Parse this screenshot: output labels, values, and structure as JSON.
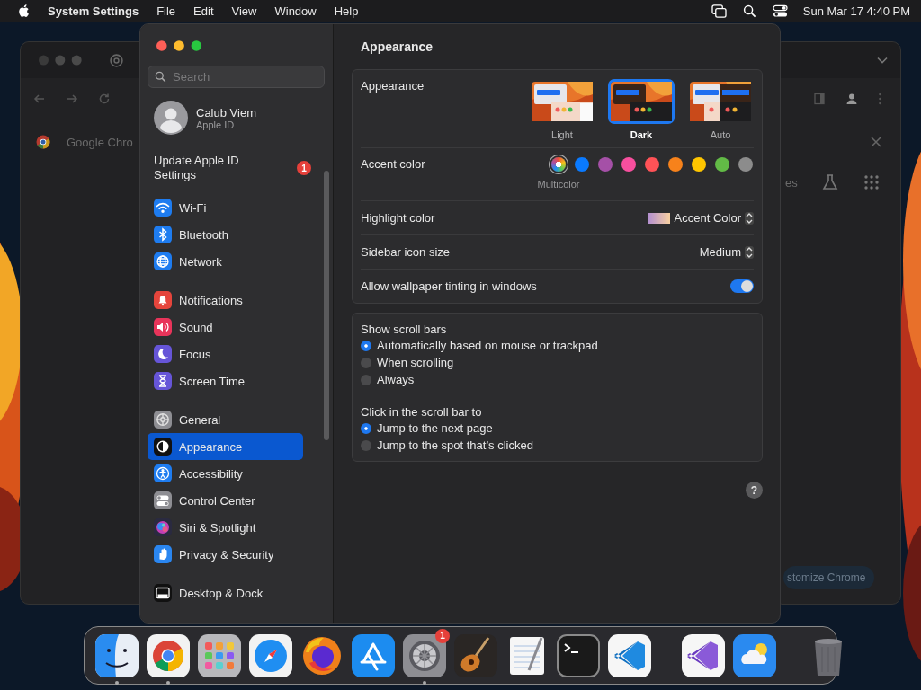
{
  "menu_bar": {
    "app_name": "System Settings",
    "menus": [
      "File",
      "Edit",
      "View",
      "Window",
      "Help"
    ],
    "clock": "Sun Mar 17  4:40 PM"
  },
  "background_windows": {
    "left_text": "Google Chro",
    "right_partial_text": "es",
    "right_button": "stomize Chrome"
  },
  "settings": {
    "title": "Appearance",
    "search": {
      "placeholder": "Search"
    },
    "account": {
      "name": "Calub Viem",
      "subtitle": "Apple ID"
    },
    "update": {
      "label": "Update Apple ID Settings",
      "badge": "1"
    },
    "sidebar": {
      "groups": [
        {
          "items": [
            {
              "label": "Wi-Fi",
              "kind": "wifi",
              "color": "#1e7cf0",
              "selected": false
            },
            {
              "label": "Bluetooth",
              "kind": "bluetooth",
              "color": "#1e7cf0",
              "selected": false
            },
            {
              "label": "Network",
              "kind": "globe",
              "color": "#1e7cf0",
              "selected": false
            }
          ]
        },
        {
          "items": [
            {
              "label": "Notifications",
              "kind": "bell",
              "color": "#e5453c",
              "selected": false
            },
            {
              "label": "Sound",
              "kind": "speaker",
              "color": "#e8345a",
              "selected": false
            },
            {
              "label": "Focus",
              "kind": "moon",
              "color": "#6655d8",
              "selected": false
            },
            {
              "label": "Screen Time",
              "kind": "hourglass",
              "color": "#6655d8",
              "selected": false
            }
          ]
        },
        {
          "items": [
            {
              "label": "General",
              "kind": "gear",
              "color": "#8e8e93",
              "selected": false
            },
            {
              "label": "Appearance",
              "kind": "contrast",
              "color": "#111111",
              "selected": true
            },
            {
              "label": "Accessibility",
              "kind": "accessibility",
              "color": "#1e7cf0",
              "selected": false
            },
            {
              "label": "Control Center",
              "kind": "toggles",
              "color": "#8e8e93",
              "selected": false
            },
            {
              "label": "Siri & Spotlight",
              "kind": "siri",
              "color": "#2a2a40",
              "selected": false
            },
            {
              "label": "Privacy & Security",
              "kind": "hand",
              "color": "#2a86f0",
              "selected": false
            }
          ]
        },
        {
          "items": [
            {
              "label": "Desktop & Dock",
              "kind": "dock",
              "color": "#111111",
              "selected": false
            }
          ]
        }
      ]
    },
    "appearance": {
      "label": "Appearance",
      "options": [
        {
          "label": "Light",
          "kind": "light",
          "selected": false
        },
        {
          "label": "Dark",
          "kind": "dark",
          "selected": true
        },
        {
          "label": "Auto",
          "kind": "auto",
          "selected": false
        }
      ]
    },
    "accent": {
      "label": "Accent color",
      "swatches": [
        {
          "kind": "multicolor",
          "label": "Multicolor",
          "selected": true
        },
        {
          "kind": "solid",
          "color": "#0a7aff",
          "selected": false
        },
        {
          "kind": "solid",
          "color": "#a550a7",
          "selected": false
        },
        {
          "kind": "solid",
          "color": "#f74f9e",
          "selected": false
        },
        {
          "kind": "solid",
          "color": "#ff5257",
          "selected": false
        },
        {
          "kind": "solid",
          "color": "#f7821b",
          "selected": false
        },
        {
          "kind": "solid",
          "color": "#ffc600",
          "selected": false
        },
        {
          "kind": "solid",
          "color": "#62ba46",
          "selected": false
        },
        {
          "kind": "solid",
          "color": "#8c8c8c",
          "selected": false
        }
      ]
    },
    "highlight": {
      "label": "Highlight color",
      "value": "Accent Color"
    },
    "icon_size": {
      "label": "Sidebar icon size",
      "value": "Medium"
    },
    "tinting": {
      "label": "Allow wallpaper tinting in windows",
      "on": true
    },
    "scroll_bars": {
      "title": "Show scroll bars",
      "options": [
        {
          "label": "Automatically based on mouse or trackpad",
          "selected": true
        },
        {
          "label": "When scrolling",
          "selected": false
        },
        {
          "label": "Always",
          "selected": false
        }
      ]
    },
    "click_scroll": {
      "title": "Click in the scroll bar to",
      "options": [
        {
          "label": "Jump to the next page",
          "selected": true
        },
        {
          "label": "Jump to the spot that’s clicked",
          "selected": false
        }
      ]
    },
    "help": "?"
  },
  "dock": {
    "groups": [
      {
        "items": [
          {
            "kind": "finder",
            "running": true
          },
          {
            "kind": "chrome",
            "running": true
          },
          {
            "kind": "launchpad",
            "running": false
          },
          {
            "kind": "safari",
            "running": false
          },
          {
            "kind": "firefox",
            "running": false
          },
          {
            "kind": "appstore",
            "running": false
          },
          {
            "kind": "settings",
            "running": true,
            "badge": "1"
          },
          {
            "kind": "guitar",
            "running": false
          },
          {
            "kind": "textedit",
            "running": false
          },
          {
            "kind": "terminal",
            "running": false
          },
          {
            "kind": "vscode",
            "running": false
          }
        ]
      },
      {
        "items": [
          {
            "kind": "visualstudio",
            "running": false
          },
          {
            "kind": "weather",
            "running": false
          }
        ]
      },
      {
        "items": [
          {
            "kind": "trash",
            "running": false
          }
        ]
      }
    ]
  }
}
